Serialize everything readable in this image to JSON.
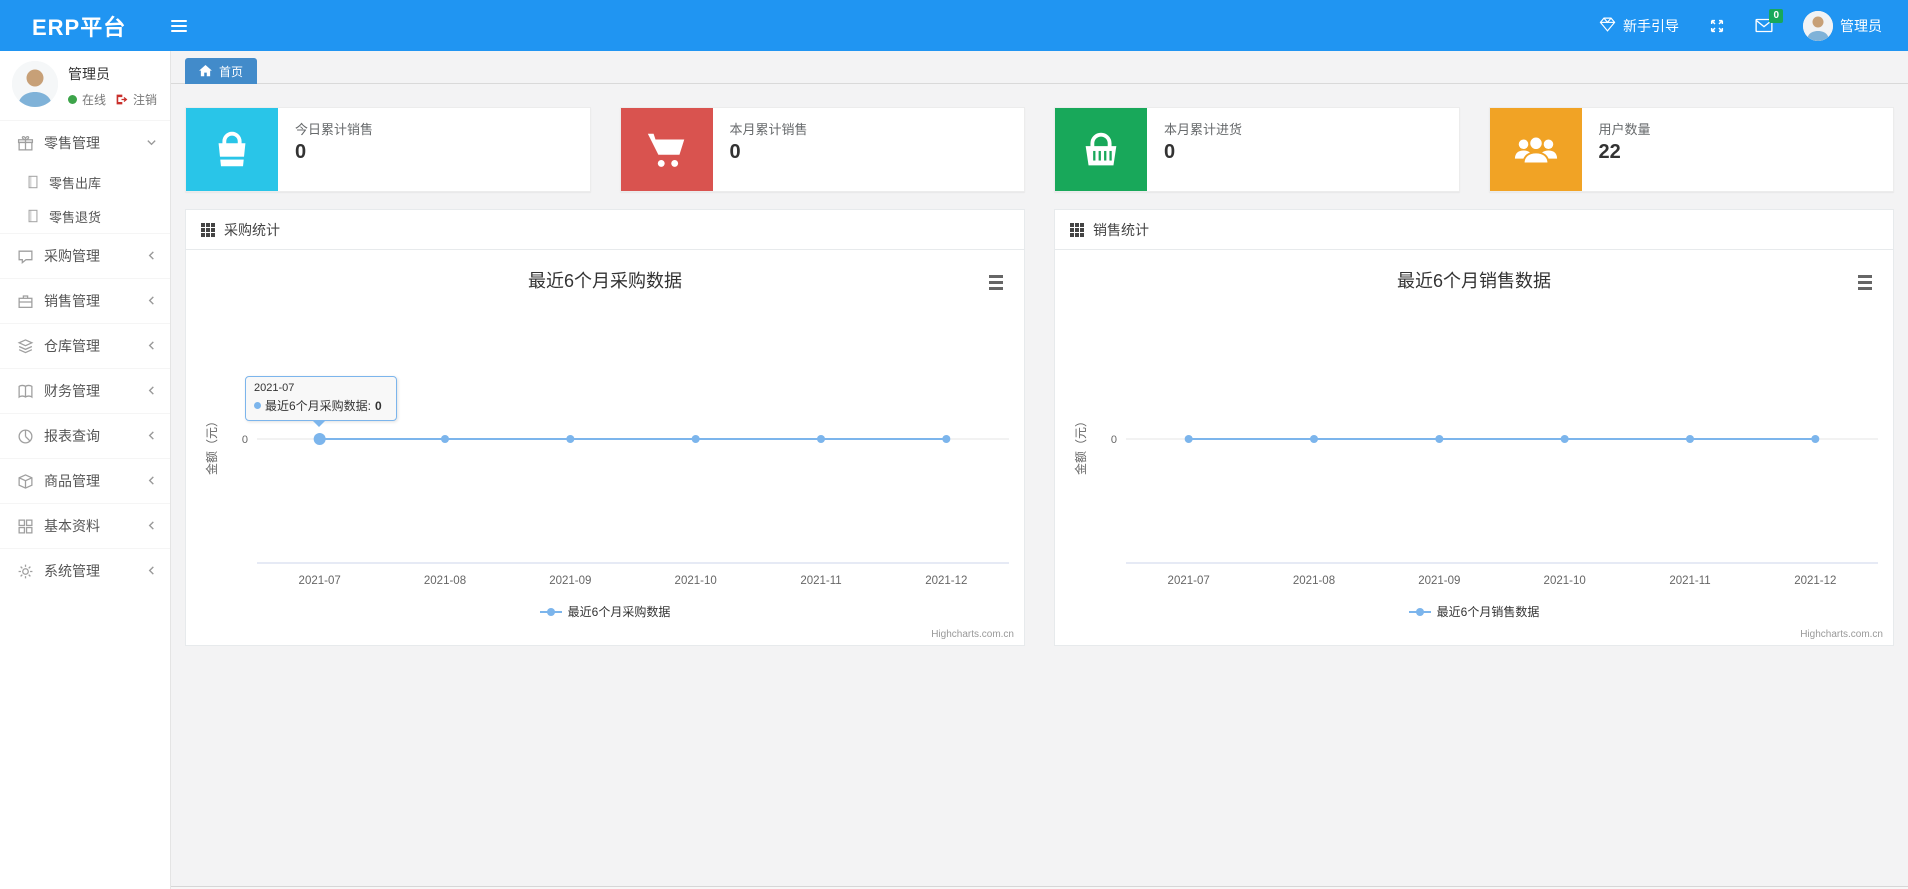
{
  "navbar": {
    "brand": "ERP平台",
    "guide_label": "新手引导",
    "mail_badge": "0",
    "username": "管理员"
  },
  "tabs": [
    {
      "label": "首页"
    }
  ],
  "sidebar": {
    "user": {
      "name": "管理员",
      "status": "在线",
      "logout": "注销"
    },
    "items": [
      {
        "label": "零售管理",
        "icon": "gift-icon",
        "expanded": true,
        "children": [
          {
            "label": "零售出库",
            "icon": "file-icon"
          },
          {
            "label": "零售退货",
            "icon": "file-icon"
          }
        ]
      },
      {
        "label": "采购管理",
        "icon": "chat-icon"
      },
      {
        "label": "销售管理",
        "icon": "briefcase-icon"
      },
      {
        "label": "仓库管理",
        "icon": "layers-icon"
      },
      {
        "label": "财务管理",
        "icon": "book-icon"
      },
      {
        "label": "报表查询",
        "icon": "pie-chart-icon"
      },
      {
        "label": "商品管理",
        "icon": "box-icon"
      },
      {
        "label": "基本资料",
        "icon": "grid-icon"
      },
      {
        "label": "系统管理",
        "icon": "gear-icon"
      }
    ]
  },
  "stat_cards": [
    {
      "label": "今日累计销售",
      "value": "0",
      "color": "#29c5e8",
      "icon": "shopping-bag-icon"
    },
    {
      "label": "本月累计销售",
      "value": "0",
      "color": "#d9534f",
      "icon": "shopping-cart-icon"
    },
    {
      "label": "本月累计进货",
      "value": "0",
      "color": "#18a85a",
      "icon": "basket-icon"
    },
    {
      "label": "用户数量",
      "value": "22",
      "color": "#f1a325",
      "icon": "users-icon"
    }
  ],
  "panels": [
    {
      "header": "采购统计",
      "chart_data": {
        "type": "line",
        "title": "最近6个月采购数据",
        "categories": [
          "2021-07",
          "2021-08",
          "2021-09",
          "2021-10",
          "2021-11",
          "2021-12"
        ],
        "series": [
          {
            "name": "最近6个月采购数据",
            "values": [
              0,
              0,
              0,
              0,
              0,
              0
            ]
          }
        ],
        "ylabel": "金额（元）",
        "yticks": [
          "0"
        ],
        "color": "#7cb5ec",
        "hover_point": 0,
        "legend_position": "bottom",
        "grid": false
      },
      "tooltip": {
        "category": "2021-07",
        "label": "最近6个月采购数据:",
        "value": "0"
      }
    },
    {
      "header": "销售统计",
      "chart_data": {
        "type": "line",
        "title": "最近6个月销售数据",
        "categories": [
          "2021-07",
          "2021-08",
          "2021-09",
          "2021-10",
          "2021-11",
          "2021-12"
        ],
        "series": [
          {
            "name": "最近6个月销售数据",
            "values": [
              0,
              0,
              0,
              0,
              0,
              0
            ]
          }
        ],
        "ylabel": "金额（元）",
        "yticks": [
          "0"
        ],
        "color": "#7cb5ec",
        "legend_position": "bottom",
        "grid": false
      }
    }
  ],
  "credit": "Highcharts.com.cn"
}
